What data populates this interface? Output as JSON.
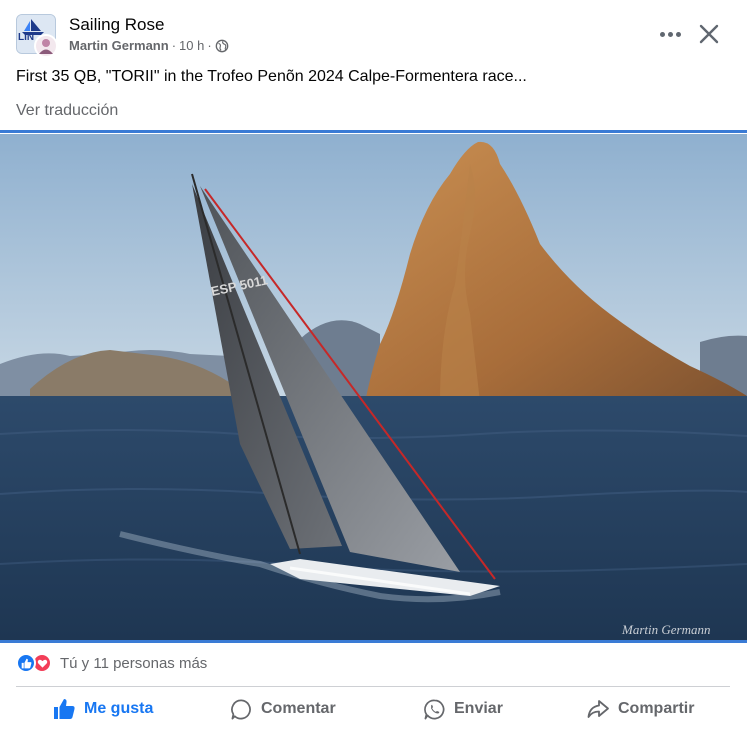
{
  "post": {
    "page_name": "Sailing Rose",
    "author": "Martin Germann",
    "time": "10 h",
    "separator": "·",
    "caption": "First 35 QB, \"TORII\" in the Trofeo Penõn 2024 Calpe-Formentera race...",
    "translate_label": "Ver traducción",
    "avatar_text": "LIN",
    "photo_watermark": "Martin Germann",
    "sail_number": "ESP 5011"
  },
  "reactions": {
    "summary": "Tú y 11 personas más",
    "types": [
      "like-icon",
      "love-icon"
    ]
  },
  "actions": {
    "like": "Me gusta",
    "comment": "Comentar",
    "send": "Enviar",
    "share": "Compartir"
  },
  "colors": {
    "accent_blue": "#1877f2",
    "love_red": "#f33e58",
    "secondary_text": "#65676b",
    "divider_blue": "#3a7bd5"
  }
}
